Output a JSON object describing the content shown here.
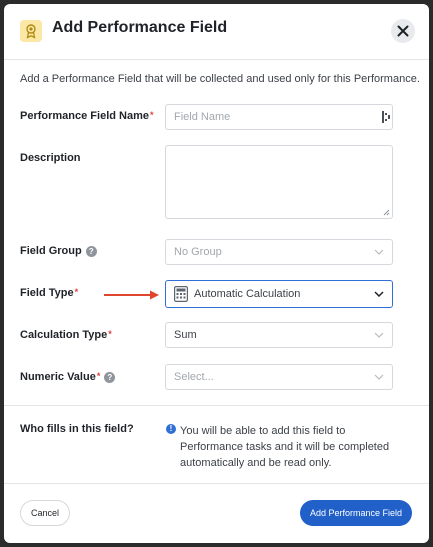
{
  "modal": {
    "title": "Add Performance Field",
    "intro": "Add a Performance Field that will be collected and used only for this Performance."
  },
  "fields": {
    "name": {
      "label": "Performance Field Name",
      "placeholder": "Field Name"
    },
    "description": {
      "label": "Description"
    },
    "group": {
      "label": "Field Group",
      "value": "No Group"
    },
    "type": {
      "label": "Field Type",
      "value": "Automatic Calculation"
    },
    "calc_type": {
      "label": "Calculation Type",
      "value": "Sum"
    },
    "numeric": {
      "label": "Numeric Value",
      "placeholder": "Select..."
    }
  },
  "required_mark": "*",
  "help_glyph": "?",
  "fill": {
    "label": "Who fills in this field?",
    "info_glyph": "!",
    "info": "You will be able to add this field to Performance tasks and it will be completed automatically and be read only."
  },
  "footer": {
    "cancel": "Cancel",
    "submit": "Add Performance Field"
  },
  "colors": {
    "primary": "#2160c9",
    "required": "#e0413c",
    "arrow": "#e0452f",
    "icon_bg": "#fbe7a6"
  },
  "icons": {
    "header": "award-icon",
    "close": "close-icon",
    "calc": "calculator-icon"
  }
}
